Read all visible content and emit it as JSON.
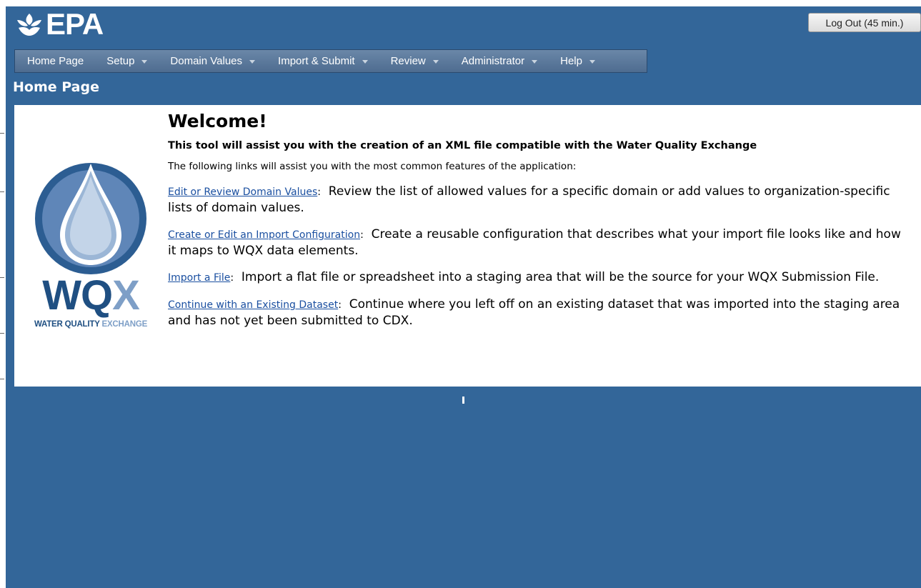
{
  "header": {
    "logo_text": "EPA",
    "logout_label": "Log Out (45 min.)"
  },
  "nav": {
    "items": [
      {
        "label": "Home Page",
        "has_dropdown": false
      },
      {
        "label": "Setup",
        "has_dropdown": true
      },
      {
        "label": "Domain Values",
        "has_dropdown": true
      },
      {
        "label": "Import & Submit",
        "has_dropdown": true
      },
      {
        "label": "Review",
        "has_dropdown": true
      },
      {
        "label": "Administrator",
        "has_dropdown": true
      },
      {
        "label": "Help",
        "has_dropdown": true
      }
    ]
  },
  "page_heading": "Home Page",
  "logo": {
    "word_main": "WQ",
    "word_accent": "X",
    "tagline_main": "WATER QUALITY",
    "tagline_accent": "EXCHANGE"
  },
  "main": {
    "welcome": "Welcome!",
    "subtitle": "This tool will assist you with the creation of an XML file compatible with the Water Quality Exchange",
    "intro": "The following links will assist you with the most common features of the application:",
    "features": [
      {
        "link": "Edit or Review Domain Values",
        "text": "Review the list of allowed values for a specific domain or add values to organization-specific lists of domain values."
      },
      {
        "link": "Create or Edit an Import Configuration",
        "text": "Create a reusable configuration that describes what your import file looks like and how it maps to WQX data elements."
      },
      {
        "link": "Import a File",
        "text": "Import a flat file or spreadsheet into a staging area that will be the source for your WQX Submission File."
      },
      {
        "link": "Continue with an Existing Dataset",
        "text": "Continue where you left off on an existing dataset that was imported into the staging area and has not yet been submitted to CDX."
      }
    ]
  },
  "colors": {
    "background": "#336699",
    "nav": "#5b7899",
    "link": "#1a4fa0",
    "logo_dark": "#1f4f82",
    "logo_light": "#7e9fc7"
  }
}
